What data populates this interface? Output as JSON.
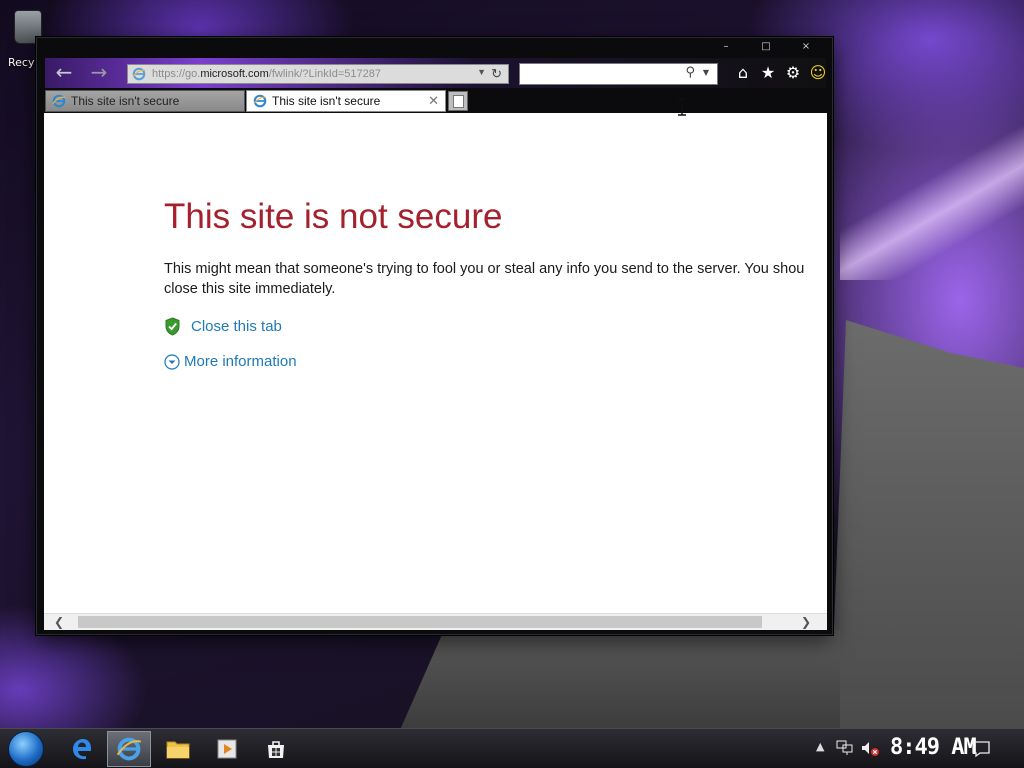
{
  "desktop": {
    "recycle_bin_label": "Recy"
  },
  "browser": {
    "window_buttons": {
      "minimize": "–",
      "maximize": "□",
      "close": "×"
    },
    "address": {
      "prefix": "https://go.",
      "domain": "microsoft.com",
      "suffix": "/fwlink/?LinkId=517287"
    },
    "search": {
      "value": ""
    },
    "tabs": [
      {
        "title": "This site isn't secure",
        "active": false
      },
      {
        "title": "This site isn't secure",
        "active": true
      }
    ],
    "toolbar_icons": [
      "home-icon",
      "favorites-star-icon",
      "settings-gear-icon",
      "feedback-smiley-icon"
    ]
  },
  "page": {
    "title": "This site is not secure",
    "body": "This might mean that someone's trying to fool you or steal any info you send to the server. You shou close this site immediately.",
    "body_line1": "This might mean that someone's trying to fool you or steal any info you send to the server. You shou",
    "body_line2": "close this site immediately.",
    "close_tab_label": "Close this tab",
    "more_info_label": "More information"
  },
  "taskbar": {
    "clock": "8:49 AM",
    "pinned": [
      "start-button",
      "edge-icon",
      "internet-explorer-icon",
      "file-explorer-icon",
      "media-player-icon",
      "store-icon"
    ]
  },
  "colors": {
    "error_title": "#a4202c",
    "link": "#1e7ab8",
    "shield_green": "#3a9a2e"
  }
}
